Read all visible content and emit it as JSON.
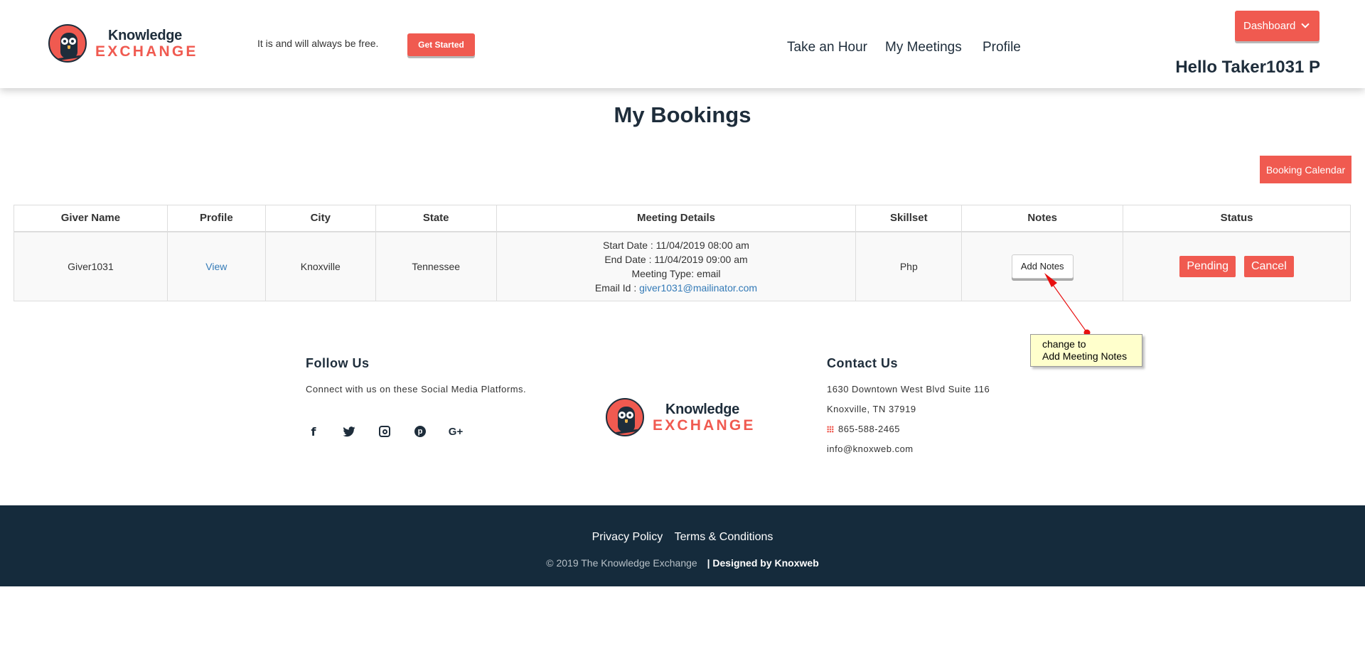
{
  "brand": {
    "name_top": "Knowledge",
    "name_bottom": "EXCHANGE"
  },
  "header": {
    "tagline": "It is and will always be free.",
    "get_started": "Get Started",
    "nav": [
      "Take an Hour",
      "My Meetings",
      "Profile"
    ],
    "dashboard": "Dashboard",
    "greeting": "Hello Taker1031 P"
  },
  "page": {
    "title": "My Bookings",
    "calendar_button": "Booking Calendar"
  },
  "table": {
    "headers": [
      "Giver Name",
      "Profile",
      "City",
      "State",
      "Meeting Details",
      "Skillset",
      "Notes",
      "Status"
    ],
    "rows": [
      {
        "giver": "Giver1031",
        "profile_link": "View",
        "city": "Knoxville",
        "state": "Tennessee",
        "start": "Start Date : 11/04/2019 08:00 am",
        "end": "End Date : 11/04/2019 09:00 am",
        "type": "Meeting Type: email",
        "email_label": "Email Id : ",
        "email": "giver1031@mailinator.com",
        "skillset": "Php",
        "notes_button": "Add Notes",
        "status": "Pending",
        "cancel": "Cancel"
      }
    ]
  },
  "annotation": {
    "line1": "change to",
    "line2": "Add Meeting Notes"
  },
  "footer": {
    "follow_title": "Follow Us",
    "follow_text": "Connect with us on these Social Media Platforms.",
    "social_icons": [
      "facebook-icon",
      "twitter-icon",
      "instagram-icon",
      "pinterest-icon",
      "google-plus-icon"
    ],
    "contact_title": "Contact Us",
    "address1": "1630 Downtown West Blvd Suite 116",
    "address2": "Knoxville, TN 37919",
    "phone": "865-588-2465",
    "email": "info@knoxweb.com",
    "links": [
      "Privacy Policy",
      "Terms & Conditions"
    ],
    "copyright": "© 2019 The Knowledge Exchange",
    "designed_by": "| Designed by Knoxweb"
  },
  "colors": {
    "accent": "#f05a50",
    "navy": "#1e2d3b",
    "footer_bg": "#152b3c",
    "link": "#337ab7"
  }
}
